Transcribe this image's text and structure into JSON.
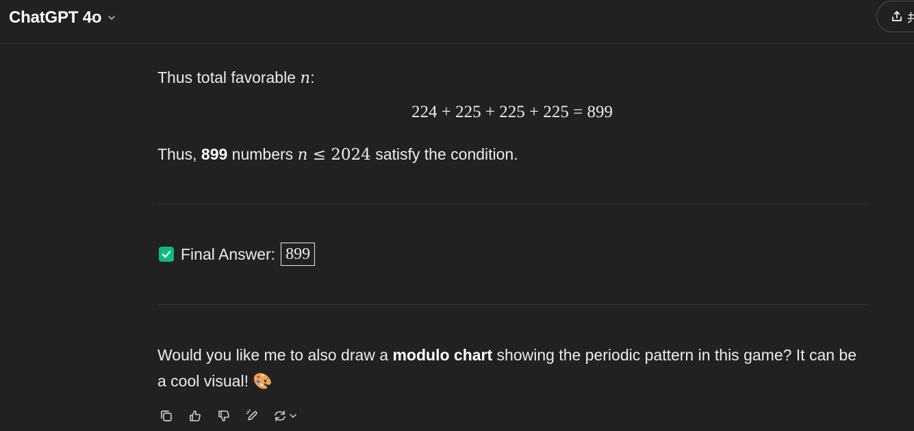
{
  "header": {
    "model_name": "ChatGPT 4o",
    "share_label": "共"
  },
  "message": {
    "line1_prefix": "Thus total favorable ",
    "line1_var": "n",
    "line1_suffix": ":",
    "equation": "224 + 225 + 225 + 225 = 899",
    "line3_prefix": "Thus, ",
    "line3_bold": "899",
    "line3_mid": " numbers ",
    "line3_math_var": "n",
    "line3_math_rest": " ≤ 2024",
    "line3_suffix": " satisfy the condition.",
    "final_answer_label": "Final Answer:",
    "final_answer_value": "899",
    "followup_prefix": "Would you like me to also draw a ",
    "followup_bold": "modulo chart",
    "followup_suffix": " showing the periodic pattern in this game? It can be a cool visual! ",
    "followup_emoji": "🎨"
  },
  "actions": {
    "icons": [
      "copy-icon",
      "thumbs-up-icon",
      "thumbs-down-icon",
      "edit-canvas-icon",
      "regenerate-icon"
    ]
  },
  "colors": {
    "background": "#212121",
    "text": "#ececec",
    "check_green": "#10b981"
  }
}
